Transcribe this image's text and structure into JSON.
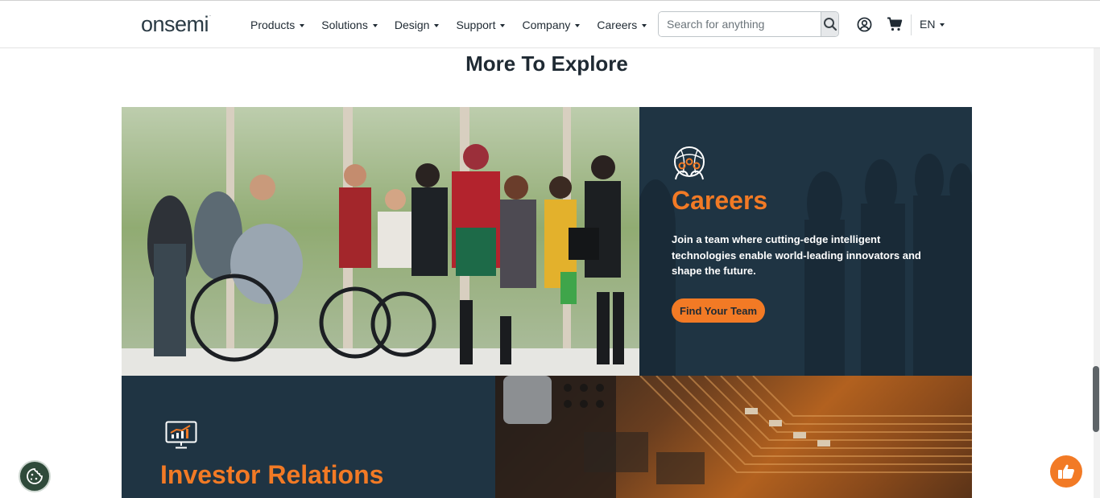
{
  "header": {
    "logo": "onsemi",
    "nav": [
      {
        "label": "Products"
      },
      {
        "label": "Solutions"
      },
      {
        "label": "Design"
      },
      {
        "label": "Support"
      },
      {
        "label": "Company"
      },
      {
        "label": "Careers"
      }
    ],
    "search": {
      "placeholder": "Search for anything"
    },
    "icons": {
      "search": "search-icon",
      "account": "user-circle-icon",
      "cart": "cart-icon"
    },
    "language": "EN"
  },
  "section": {
    "title": "More To Explore"
  },
  "careers": {
    "icon": "team-network-icon",
    "title": "Careers",
    "description": "Join a team where cutting-edge intelligent technologies enable world-leading innovators and shape the future.",
    "button_label": "Find Your Team"
  },
  "investor": {
    "icon": "presentation-chart-icon",
    "title": "Investor Relations"
  },
  "floating": {
    "cookie": "cookie-icon",
    "feedback": "thumbs-up-icon"
  },
  "colors": {
    "accent": "#f27a25",
    "panel": "#1f3443",
    "text": "#1f2a33"
  }
}
